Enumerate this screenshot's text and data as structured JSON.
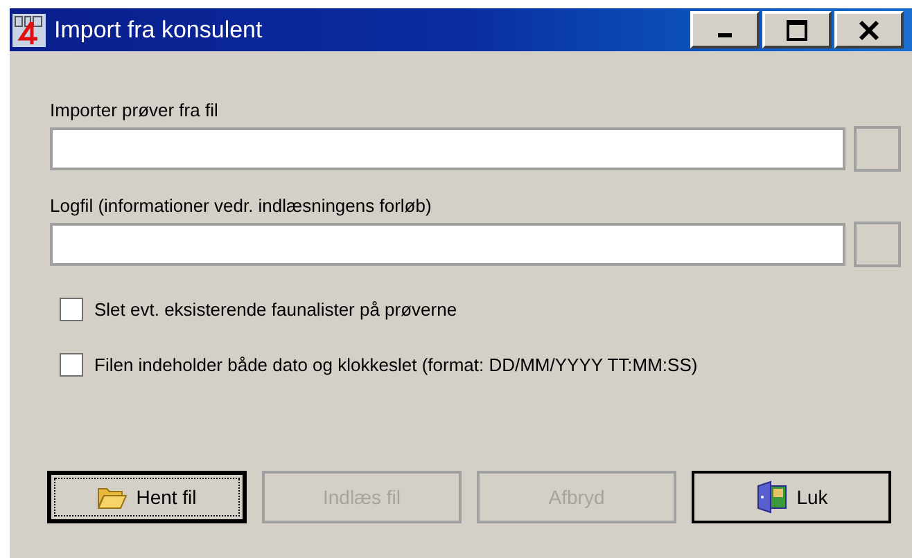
{
  "window": {
    "title": "Import fra konsulent"
  },
  "fields": [
    {
      "label": "Importer prøver fra fil"
    },
    {
      "label": "Logfil (informationer vedr. indlæsningens forløb)"
    }
  ],
  "checkboxes": [
    {
      "label": "Slet evt. eksisterende faunalister på prøverne",
      "checked": false
    },
    {
      "label": "Filen indeholder både dato og klokkeslet (format: DD/MM/YYYY TT:MM:SS)",
      "checked": false
    }
  ],
  "buttons": [
    {
      "label": "Hent fil",
      "kind": "folder",
      "disabled": false,
      "focused": true
    },
    {
      "label": "Indlæs fil",
      "kind": "plain",
      "disabled": true,
      "focused": false
    },
    {
      "label": "Afbryd",
      "kind": "plain",
      "disabled": true,
      "focused": false
    },
    {
      "label": "Luk",
      "kind": "exit",
      "disabled": false,
      "focused": false
    }
  ]
}
